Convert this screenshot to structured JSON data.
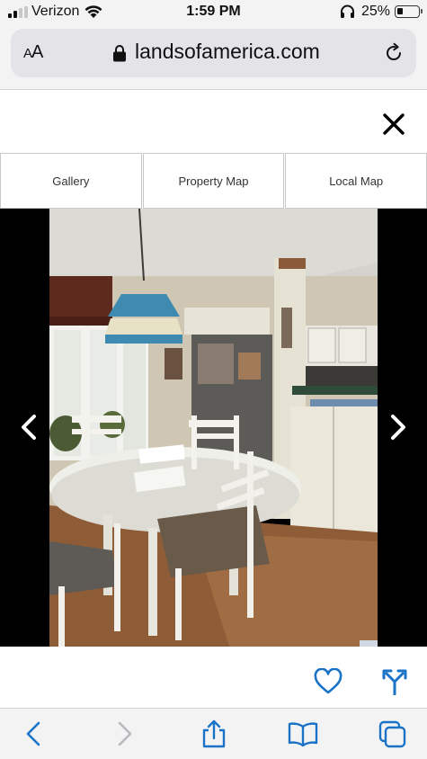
{
  "status_bar": {
    "carrier": "Verizon",
    "time": "1:59 PM",
    "battery_percent": "25%",
    "battery_level": 0.25,
    "signal_bars": 2
  },
  "address_bar": {
    "reader_label": "AA",
    "url": "landsofamerica.com"
  },
  "tabs": [
    {
      "label": "Gallery"
    },
    {
      "label": "Property Map"
    },
    {
      "label": "Local Map"
    }
  ],
  "gallery": {
    "photo_description_icon": "dining-room-photo"
  },
  "icons": {
    "close": "close-icon",
    "prev": "chevron-left-icon",
    "next": "chevron-right-icon",
    "favorite": "heart-icon",
    "directions": "directions-icon"
  },
  "colors": {
    "accent": "#1a73c7",
    "toolbar_icon": "#1a73c7",
    "disabled": "#b9b9bd"
  }
}
